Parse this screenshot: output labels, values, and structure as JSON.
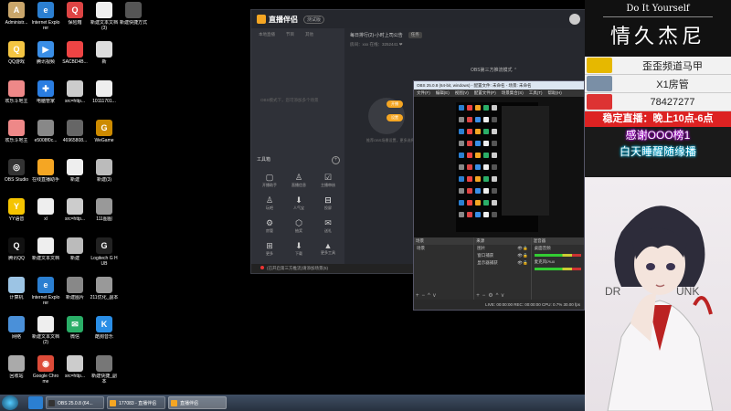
{
  "desktop": {
    "icons": [
      {
        "label": "Administr...",
        "color": "#c9a66b",
        "glyph": "A"
      },
      {
        "label": "Internet Explorer",
        "color": "#2b7fd1",
        "glyph": "e"
      },
      {
        "label": "保险箱",
        "color": "#d44",
        "glyph": "Q"
      },
      {
        "label": "新建文本文档 (3)",
        "color": "#eee",
        "glyph": ""
      },
      {
        "label": "新建快捷方式",
        "color": "#555",
        "glyph": ""
      },
      {
        "label": "QQ游戏",
        "color": "#f4c542",
        "glyph": "Q"
      },
      {
        "label": "腾讯视频",
        "color": "#3a8ee6",
        "glyph": "▶"
      },
      {
        "label": "SACBD4B...",
        "color": "#e44",
        "glyph": ""
      },
      {
        "label": "新",
        "color": "#ddd",
        "glyph": ""
      },
      {
        "label": "",
        "color": "#000",
        "glyph": ""
      },
      {
        "label": "欢乐斗地主",
        "color": "#e88",
        "glyph": ""
      },
      {
        "label": "电脑管家",
        "color": "#2a7de1",
        "glyph": "✚"
      },
      {
        "label": "src=http...",
        "color": "#ccc",
        "glyph": ""
      },
      {
        "label": "10111701...",
        "color": "#eee",
        "glyph": ""
      },
      {
        "label": "",
        "color": "#000",
        "glyph": ""
      },
      {
        "label": "欢乐斗地主",
        "color": "#e88",
        "glyph": ""
      },
      {
        "label": "e5008f0c...",
        "color": "#888",
        "glyph": ""
      },
      {
        "label": "46965808...",
        "color": "#666",
        "glyph": ""
      },
      {
        "label": "WeGame",
        "color": "#cc8a00",
        "glyph": "G"
      },
      {
        "label": "",
        "color": "#000",
        "glyph": ""
      },
      {
        "label": "OBS Studio",
        "color": "#333",
        "glyph": "◎"
      },
      {
        "label": "在线直播助手",
        "color": "#f5a623",
        "glyph": ""
      },
      {
        "label": "新建",
        "color": "#eee",
        "glyph": ""
      },
      {
        "label": "新建(3)",
        "color": "#bbb",
        "glyph": ""
      },
      {
        "label": "",
        "color": "#000",
        "glyph": ""
      },
      {
        "label": "YY语音",
        "color": "#f5c400",
        "glyph": "Y"
      },
      {
        "label": "xl",
        "color": "#eee",
        "glyph": ""
      },
      {
        "label": "src=http...",
        "color": "#ccc",
        "glyph": ""
      },
      {
        "label": "111图图",
        "color": "#999",
        "glyph": ""
      },
      {
        "label": "",
        "color": "#000",
        "glyph": ""
      },
      {
        "label": "腾讯QQ",
        "color": "#111",
        "glyph": "Q"
      },
      {
        "label": "新建文本文档",
        "color": "#eee",
        "glyph": ""
      },
      {
        "label": "新建",
        "color": "#bbb",
        "glyph": ""
      },
      {
        "label": "Logitech G HUB",
        "color": "#222",
        "glyph": "G"
      },
      {
        "label": "",
        "color": "#000",
        "glyph": ""
      },
      {
        "label": "计算机",
        "color": "#9cc4e4",
        "glyph": ""
      },
      {
        "label": "Internet Explorer",
        "color": "#2b7fd1",
        "glyph": "e"
      },
      {
        "label": "新建图片",
        "color": "#888",
        "glyph": ""
      },
      {
        "label": "211优化_副本",
        "color": "#999",
        "glyph": ""
      },
      {
        "label": "",
        "color": "#000",
        "glyph": ""
      },
      {
        "label": "网络",
        "color": "#4a90d9",
        "glyph": ""
      },
      {
        "label": "新建文本文档 (2)",
        "color": "#eee",
        "glyph": ""
      },
      {
        "label": "微信",
        "color": "#2aae67",
        "glyph": "✉"
      },
      {
        "label": "酷狗音乐",
        "color": "#2a8ee6",
        "glyph": "K"
      },
      {
        "label": "",
        "color": "#000",
        "glyph": ""
      },
      {
        "label": "回收站",
        "color": "#aaa",
        "glyph": ""
      },
      {
        "label": "Google Chrome",
        "color": "#dd4b39",
        "glyph": "◉"
      },
      {
        "label": "src=http...",
        "color": "#ccc",
        "glyph": ""
      },
      {
        "label": "新建快捷_副本",
        "color": "#777",
        "glyph": ""
      },
      {
        "label": "",
        "color": "#000",
        "glyph": ""
      }
    ]
  },
  "zhibo": {
    "title": "直播伴侣",
    "version": "测试版",
    "left_tabs": [
      "本地直播",
      "节目",
      "其他"
    ],
    "scene_text": "OBS模式下，您可添加多个场景",
    "tools_header": "工具箱",
    "tools": [
      {
        "label": "开播助手",
        "icon": "▢"
      },
      {
        "label": "直播信息",
        "icon": "♙"
      },
      {
        "label": "主播审核",
        "icon": "☑"
      },
      {
        "label": "玩吧",
        "icon": "♙"
      },
      {
        "label": "人气宝",
        "icon": "⬇"
      },
      {
        "label": "投屏",
        "icon": "⊟"
      },
      {
        "label": "房管",
        "icon": "⚙"
      },
      {
        "label": "抽奖",
        "icon": "⬡"
      },
      {
        "label": "送礼",
        "icon": "✉"
      },
      {
        "label": "更多",
        "icon": "⊞"
      },
      {
        "label": "下载",
        "icon": "⬇"
      },
      {
        "label": "更多工具",
        "icon": "▲"
      }
    ],
    "ticker": "每日排行(2)-小时上司公告",
    "ticker_chip": "任务",
    "stats": "房间：xxx 在线：3252441 ❤",
    "mode_label": "OBS第三方推流模式 ⌃",
    "pill_top": "开播",
    "pill_bottom": "设置",
    "hint": "推荐OBS场景设置，更多选择",
    "bottom_status": "(已开启第三方推流)请添加场景(5)"
  },
  "obs": {
    "title": "OBS 25.0.8 (64-bit, windows) - 配置文件: 未命名 - 场景: 未命名",
    "menu": [
      "文件(F)",
      "编辑(E)",
      "视图(V)",
      "配置文件(P)",
      "场景集合(S)",
      "工具(T)",
      "帮助(H)"
    ],
    "docks": {
      "scenes": {
        "header": "场景",
        "items": [
          "场景"
        ]
      },
      "sources": {
        "header": "来源",
        "items": [
          "图片",
          "窗口捕获",
          "显示器捕获"
        ]
      },
      "mixer": {
        "header": "混音器",
        "items": [
          "桌面音频",
          "麦克风/Aux"
        ]
      }
    },
    "status": "LIVE: 00:00:00  REC: 00:00:00  CPU: 0.7%  30.00 fps"
  },
  "panel": {
    "brand_sub": "Do It Yourself",
    "brand_main": "情久杰尼",
    "ranks": [
      {
        "text": "歪歪频道马甲",
        "color": "#e6b800"
      },
      {
        "text": "X1房管",
        "color": "#7a8fa6"
      },
      {
        "text": "78427277",
        "color": "#d33"
      }
    ],
    "notice": "稳定直播：晚上10点-6点",
    "thanks": "感谢OOO榜1",
    "match": "白天睡醒随缘播",
    "watermark_left": "DR",
    "watermark_right": "UNK"
  },
  "taskbar": {
    "tasks": [
      {
        "label": "OBS 25.0.8 (64...",
        "color": "#333"
      },
      {
        "label": "177083 - 直播伴侣",
        "color": "#f5a623"
      },
      {
        "label": "直播伴侣",
        "color": "#f5a623"
      }
    ]
  }
}
